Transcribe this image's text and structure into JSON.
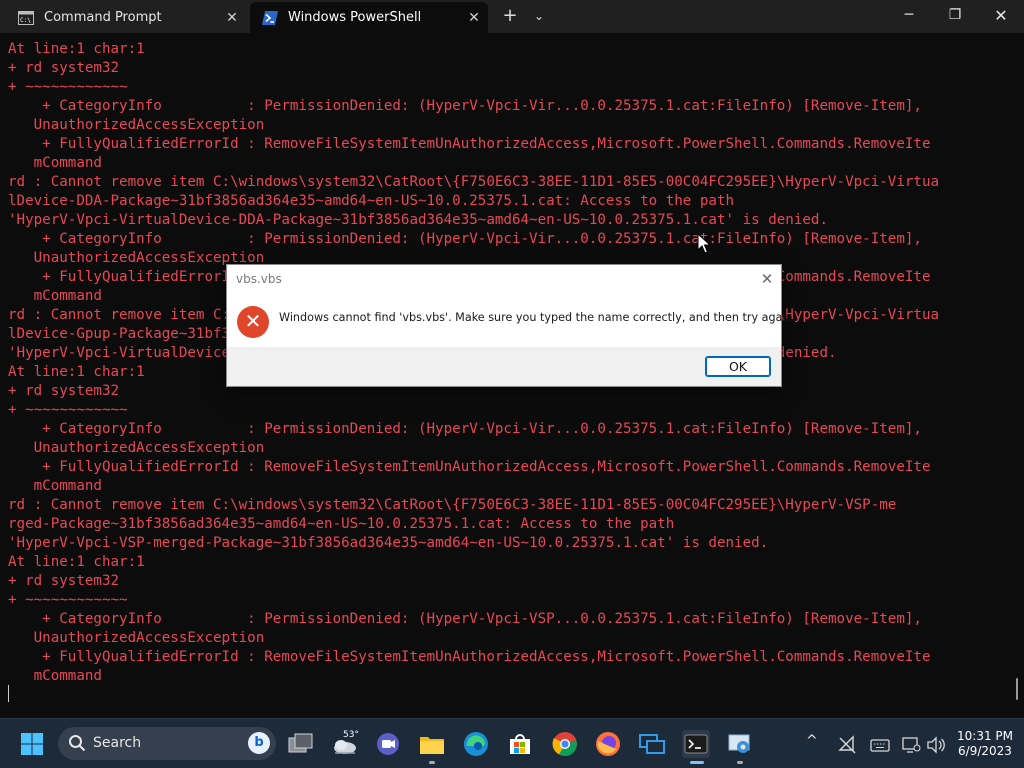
{
  "window": {
    "tabs": [
      {
        "label": "Command Prompt",
        "active": false
      },
      {
        "label": "Windows PowerShell",
        "active": true
      }
    ],
    "new_tab_symbol": "+",
    "dropdown_symbol": "⌄",
    "minimize_symbol": "─",
    "maximize_symbol": "❐",
    "close_symbol": "✕",
    "tab_close_symbol": "✕"
  },
  "terminal": {
    "text_color": "#e74856",
    "background": "#0c0c0c",
    "lines": [
      "At line:1 char:1",
      "+ rd system32",
      "+ ~~~~~~~~~~~~",
      "    + CategoryInfo          : PermissionDenied: (HyperV-Vpci-Vir...0.0.25375.1.cat:FileInfo) [Remove-Item],",
      "   UnauthorizedAccessException",
      "    + FullyQualifiedErrorId : RemoveFileSystemItemUnAuthorizedAccess,Microsoft.PowerShell.Commands.RemoveIte",
      "   mCommand",
      "rd : Cannot remove item C:\\windows\\system32\\CatRoot\\{F750E6C3-38EE-11D1-85E5-00C04FC295EE}\\HyperV-Vpci-Virtua",
      "lDevice-DDA-Package~31bf3856ad364e35~amd64~en-US~10.0.25375.1.cat: Access to the path",
      "'HyperV-Vpci-VirtualDevice-DDA-Package~31bf3856ad364e35~amd64~en-US~10.0.25375.1.cat' is denied.",
      "    + CategoryInfo          : PermissionDenied: (HyperV-Vpci-Vir...0.0.25375.1.cat:FileInfo) [Remove-Item],",
      "   UnauthorizedAccessException",
      "    + FullyQualifiedErrorId : RemoveFileSystemItemUnAuthorizedAccess,Microsoft.PowerShell.Commands.RemoveIte",
      "   mCommand",
      "rd : Cannot remove item C:\\windows\\system32\\CatRoot\\{F750E6C3-38EE-11D1-85E5-00C04FC295EE}\\HyperV-Vpci-Virtua",
      "lDevice-Gpup-Package~31bf3856ad364e35~amd64~en-US~10.0.25375.1.cat: Access to the path",
      "'HyperV-Vpci-VirtualDevice-Gpup-Package~31bf3856ad364e35~amd64~en-US~10.0.25375.1.cat' is denied.",
      "At line:1 char:1",
      "+ rd system32",
      "+ ~~~~~~~~~~~~",
      "    + CategoryInfo          : PermissionDenied: (HyperV-Vpci-Vir...0.0.25375.1.cat:FileInfo) [Remove-Item],",
      "   UnauthorizedAccessException",
      "    + FullyQualifiedErrorId : RemoveFileSystemItemUnAuthorizedAccess,Microsoft.PowerShell.Commands.RemoveIte",
      "   mCommand",
      "rd : Cannot remove item C:\\windows\\system32\\CatRoot\\{F750E6C3-38EE-11D1-85E5-00C04FC295EE}\\HyperV-VSP-me",
      "rged-Package~31bf3856ad364e35~amd64~en-US~10.0.25375.1.cat: Access to the path",
      "'HyperV-Vpci-VSP-merged-Package~31bf3856ad364e35~amd64~en-US~10.0.25375.1.cat' is denied.",
      "At line:1 char:1",
      "+ rd system32",
      "+ ~~~~~~~~~~~~",
      "    + CategoryInfo          : PermissionDenied: (HyperV-Vpci-VSP...0.0.25375.1.cat:FileInfo) [Remove-Item],",
      "   UnauthorizedAccessException",
      "    + FullyQualifiedErrorId : RemoveFileSystemItemUnAuthorizedAccess,Microsoft.PowerShell.Commands.RemoveIte",
      "   mCommand"
    ]
  },
  "dialog": {
    "title": "vbs.vbs",
    "close_symbol": "✕",
    "icon": "error-icon",
    "icon_symbol": "✕",
    "message": "Windows cannot find 'vbs.vbs'. Make sure you typed the name correctly, and then try again.",
    "ok_label": "OK"
  },
  "taskbar": {
    "search_label": "Search",
    "bing_label": "b",
    "weather_temp": "53°",
    "clock_time": "10:31 PM",
    "clock_date": "6/9/2023",
    "tray_chevron": "^",
    "colors": {
      "background": "#1c2a3a",
      "accent": "#0067c0"
    }
  }
}
